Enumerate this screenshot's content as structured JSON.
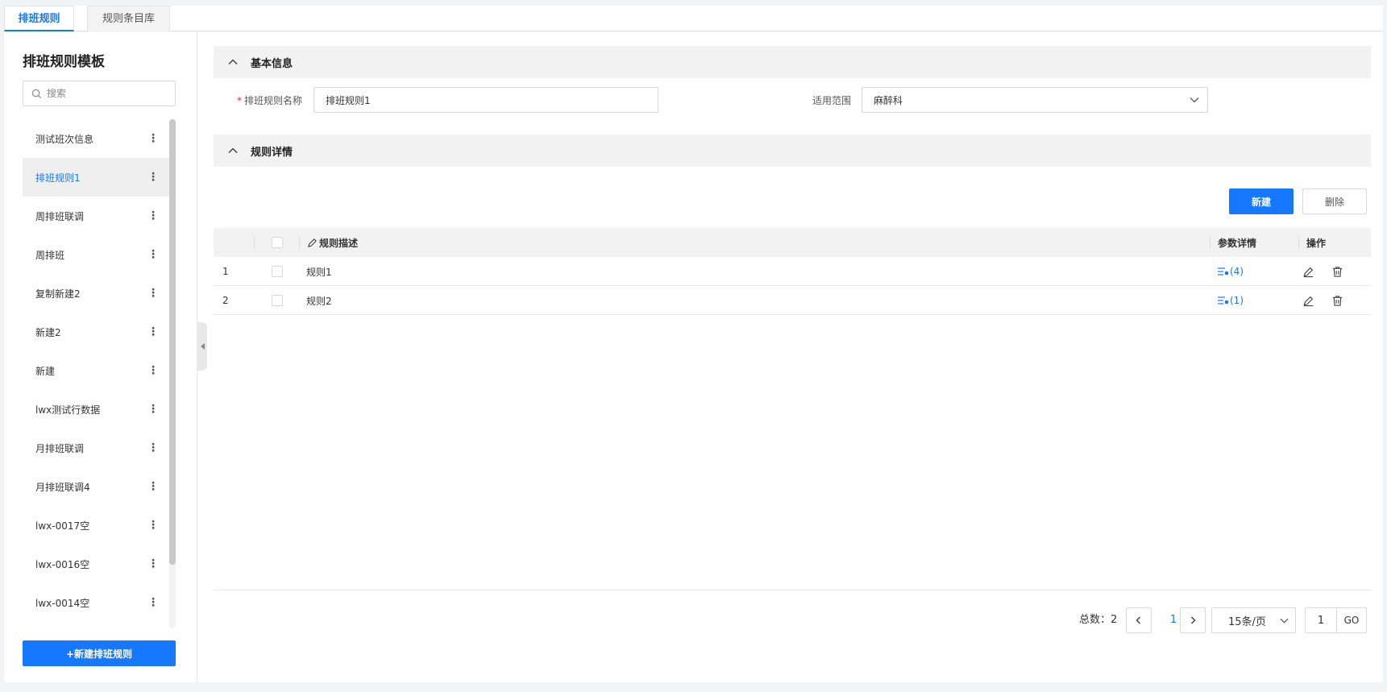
{
  "tabs": [
    {
      "label": "排班规则",
      "active": true
    },
    {
      "label": "规则条目库",
      "active": false
    }
  ],
  "sidebar": {
    "title": "排班规则模板",
    "search_placeholder": "搜索",
    "items": [
      {
        "label": "测试班次信息"
      },
      {
        "label": "排班规则1"
      },
      {
        "label": "周排班联调"
      },
      {
        "label": "周排班"
      },
      {
        "label": "复制新建2"
      },
      {
        "label": "新建2"
      },
      {
        "label": "新建"
      },
      {
        "label": "lwx测试行数据"
      },
      {
        "label": "月排班联调"
      },
      {
        "label": "月排班联调4"
      },
      {
        "label": "lwx-0017空"
      },
      {
        "label": "lwx-0016空"
      },
      {
        "label": "lwx-0014空"
      }
    ],
    "selected_index": 1,
    "new_button": "+新建排班规则"
  },
  "basic_info": {
    "section_title": "基本信息",
    "name_label": "排班规则名称",
    "name_value": "排班规则1",
    "scope_label": "适用范围",
    "scope_value": "麻醉科"
  },
  "rule_details": {
    "section_title": "规则详情",
    "new_button": "新建",
    "delete_button": "删除",
    "columns": {
      "description": "规则描述",
      "params": "参数详情",
      "actions": "操作"
    },
    "rows": [
      {
        "index": "1",
        "description": "规则1",
        "params": "(4)"
      },
      {
        "index": "2",
        "description": "规则2",
        "params": "(1)"
      }
    ]
  },
  "pagination": {
    "total_text": "总数：2",
    "current_page": "1",
    "page_size": "15条/页",
    "jump_value": "1",
    "go_label": "GO"
  },
  "colors": {
    "accent": "#1677ff",
    "required": "#f5222d"
  }
}
